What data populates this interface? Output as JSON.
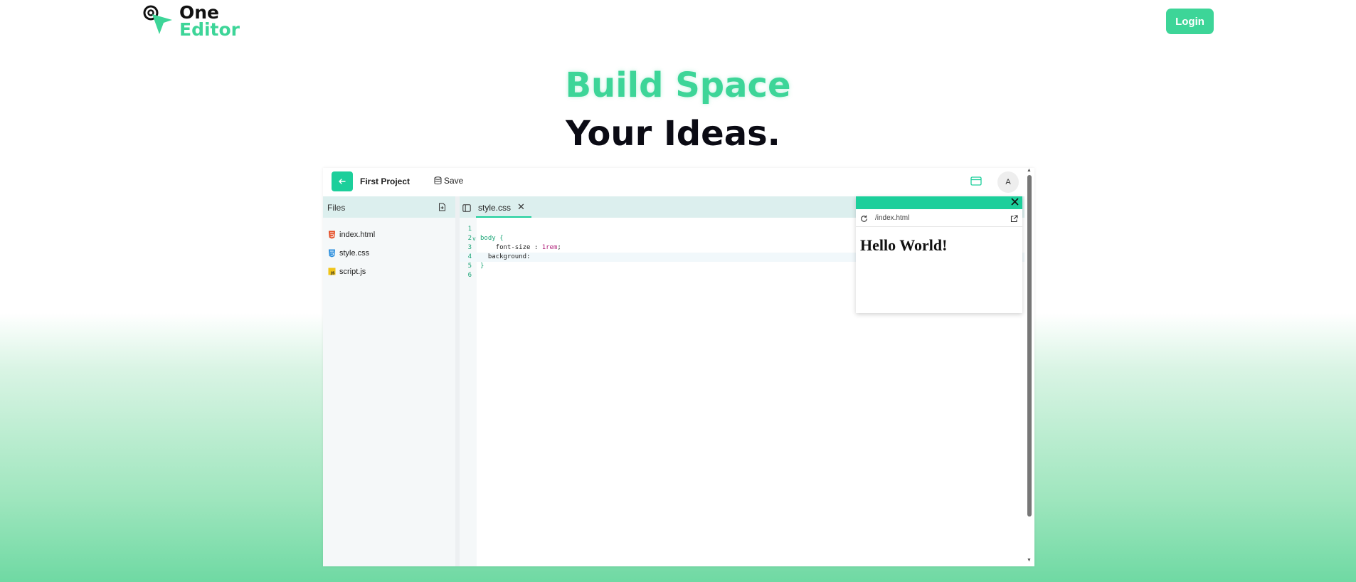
{
  "header": {
    "logo_line1": "One",
    "logo_line2": "Editor",
    "login_label": "Login"
  },
  "hero": {
    "line1": "Build Space",
    "line2": "Your Ideas."
  },
  "editor": {
    "project_name": "First Project",
    "save_label": "Save",
    "avatar_initial": "A",
    "sidebar": {
      "title": "Files",
      "files": [
        {
          "name": "index.html",
          "icon": "html-file-icon"
        },
        {
          "name": "style.css",
          "icon": "css-file-icon"
        },
        {
          "name": "script.js",
          "icon": "js-file-icon"
        }
      ]
    },
    "tabs": [
      {
        "label": "style.css",
        "close": "✕"
      }
    ],
    "code_lines": [
      {
        "n": "1",
        "fold": "",
        "text": ""
      },
      {
        "n": "2",
        "fold": "v",
        "text": "body {"
      },
      {
        "n": "3",
        "fold": "",
        "text": "    font-size : 1rem;"
      },
      {
        "n": "4",
        "fold": "",
        "text": "  background:"
      },
      {
        "n": "5",
        "fold": "",
        "text": "}"
      },
      {
        "n": "6",
        "fold": "",
        "text": ""
      }
    ],
    "preview": {
      "url": "/index.html",
      "content": "Hello World!"
    }
  },
  "colors": {
    "accent": "#3dd598",
    "accent_dark": "#1ccf9b"
  }
}
